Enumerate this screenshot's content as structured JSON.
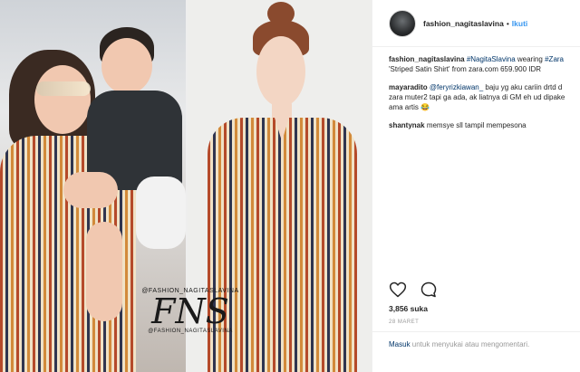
{
  "post": {
    "username": "fashion_nagitaslavina",
    "separator": "•",
    "follow_label": "Ikuti",
    "caption": {
      "username": "fashion_nagitaslavina",
      "tag1": "#NagitaSlavina",
      "text1": " wearing ",
      "tag2": "#Zara",
      "text2": " 'Striped Satin Shirt' from zara.com 659.900 IDR"
    },
    "comments": [
      {
        "username": "mayaradito",
        "mention": "@feryrizkiawan_",
        "text": " baju yg aku cariin drtd d zara muter2 tapi ga ada, ak liatnya di GM eh ud dipake ama artis 😂"
      },
      {
        "username": "shantynak",
        "text": "memsye sll tampil mempesona"
      }
    ],
    "likes": "3,856 suka",
    "date": "28 MARET",
    "login": {
      "link": "Masuk",
      "text": " untuk menyukai atau mengomentari."
    },
    "watermark": {
      "top": "@FASHION_NAGITASLAVINA",
      "mid": "FNS",
      "bottom": "@FASHION_NAGITASLAVINA"
    },
    "icons": [
      "heart-icon",
      "comment-icon"
    ]
  }
}
